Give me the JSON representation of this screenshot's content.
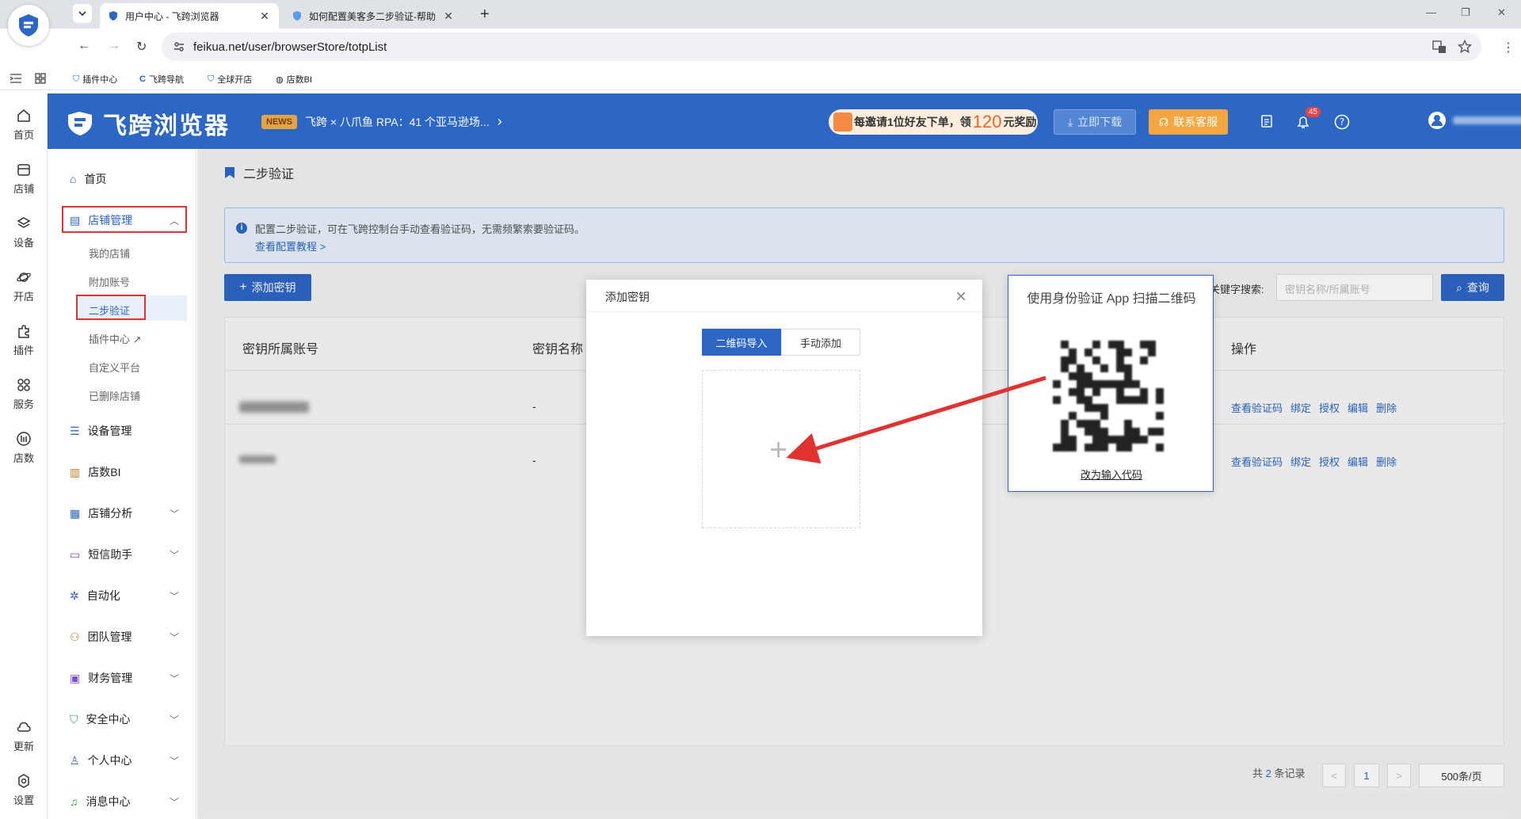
{
  "browser": {
    "tabs": [
      {
        "label": "用户中心 - 飞跨浏览器"
      },
      {
        "label": "如何配置美客多二步验证-帮助"
      }
    ],
    "new_tab": "+",
    "url": "feikua.net/user/browserStore/totpList",
    "bookmarks": [
      {
        "label": "插件中心"
      },
      {
        "label": "飞跨导航"
      },
      {
        "label": "全球开店"
      },
      {
        "label": "店数BI"
      }
    ]
  },
  "rail": {
    "items": [
      {
        "label": "首页",
        "icon": "home-icon"
      },
      {
        "label": "店铺",
        "icon": "store-icon"
      },
      {
        "label": "设备",
        "icon": "layers-icon"
      },
      {
        "label": "开店",
        "icon": "planet-icon"
      },
      {
        "label": "插件",
        "icon": "puzzle-icon"
      },
      {
        "label": "服务",
        "icon": "grid-icon"
      },
      {
        "label": "店数",
        "icon": "bi-icon"
      },
      {
        "label": "更新",
        "icon": "cloud-icon"
      },
      {
        "label": "设置",
        "icon": "gear-icon"
      }
    ]
  },
  "header": {
    "logo_text": "飞跨浏览器",
    "news_badge": "NEWS",
    "news_text": "飞跨 × 八爪鱼 RPA：41 个亚马逊场...",
    "promo_prefix": "每邀请1位好友下单，领",
    "promo_amount": "120",
    "promo_suffix": "元奖励",
    "download_label": "立即下载",
    "support_label": "联系客服",
    "notification_count": "45",
    "accent": "#2d67c6"
  },
  "sidebar": {
    "items": [
      {
        "label": "首页"
      },
      {
        "label": "店铺管理"
      },
      {
        "label": "设备管理"
      },
      {
        "label": "店数BI"
      },
      {
        "label": "店铺分析"
      },
      {
        "label": "短信助手"
      },
      {
        "label": "自动化"
      },
      {
        "label": "团队管理"
      },
      {
        "label": "财务管理"
      },
      {
        "label": "安全中心"
      },
      {
        "label": "个人中心"
      },
      {
        "label": "消息中心"
      }
    ],
    "sub_items": [
      {
        "label": "我的店铺"
      },
      {
        "label": "附加账号"
      },
      {
        "label": "二步验证"
      },
      {
        "label": "插件中心"
      },
      {
        "label": "自定义平台"
      },
      {
        "label": "已删除店铺"
      }
    ]
  },
  "main": {
    "page_title": "二步验证",
    "info_text": "配置二步验证，可在飞跨控制台手动查看验证码，无需频繁索要验证码。",
    "info_link": "查看配置教程 >",
    "add_key_label": "添加密钥",
    "search_label": "关键字搜索:",
    "search_placeholder": "密钥名称/所属账号",
    "query_label": "查询",
    "table": {
      "headers": [
        "密钥所属账号",
        "密钥名称",
        "操作"
      ],
      "rows": [
        {
          "name": "-",
          "ops": [
            "查看验证码",
            "绑定",
            "授权",
            "编辑",
            "删除"
          ]
        },
        {
          "name": "-",
          "ops": [
            "查看验证码",
            "绑定",
            "授权",
            "编辑",
            "删除"
          ]
        }
      ]
    },
    "pagination": {
      "total_prefix": "共",
      "total": "2",
      "total_suffix": "条记录",
      "prev": "<",
      "page": "1",
      "next": ">",
      "page_size": "500条/页"
    }
  },
  "modal": {
    "title": "添加密钥",
    "close": "×",
    "tab_qr": "二维码导入",
    "tab_manual": "手动添加",
    "upload_plus": "+"
  },
  "qr_popup": {
    "text": "使用身份验证 App 扫描二维码",
    "link": "改为输入代码"
  }
}
